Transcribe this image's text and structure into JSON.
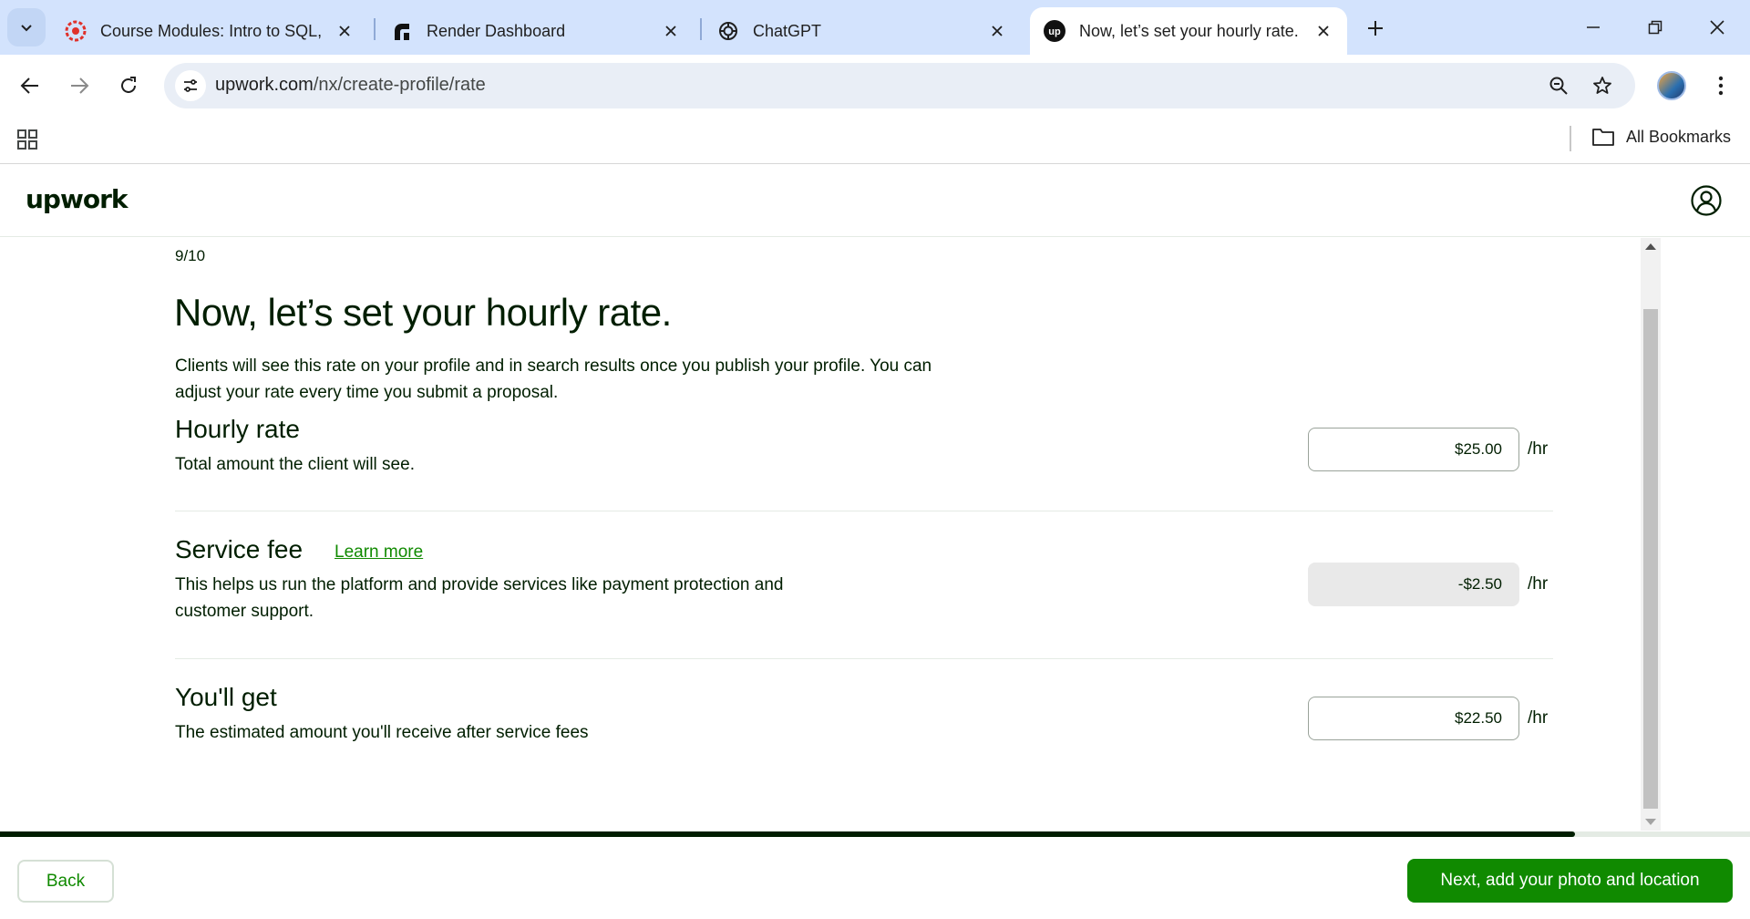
{
  "browser": {
    "tabs": [
      {
        "title": "Course Modules: Intro to SQL, S",
        "icon": "course-favicon"
      },
      {
        "title": "Render Dashboard",
        "icon": "render-favicon"
      },
      {
        "title": "ChatGPT",
        "icon": "chatgpt-favicon"
      },
      {
        "title": "Now, let’s set your hourly rate.",
        "icon": "upwork-favicon",
        "active": true
      }
    ],
    "url_host": "upwork.com",
    "url_path": "/nx/create-profile/rate",
    "bookmarks_label": "All Bookmarks"
  },
  "site": {
    "logo": "upwork"
  },
  "page": {
    "step": "9/10",
    "headline": "Now, let’s set your hourly rate.",
    "intro": "Clients will see this rate on your profile and in search results once you publish your profile. You can adjust your rate every time you submit a proposal.",
    "hourly": {
      "title": "Hourly rate",
      "desc": "Total amount the client will see.",
      "value": "$25.00",
      "unit": "/hr"
    },
    "fee": {
      "title": "Service fee",
      "learn_more": "Learn more",
      "desc": "This helps us run the platform and provide services like payment protection and customer support.",
      "value": "-$2.50",
      "unit": "/hr"
    },
    "net": {
      "title": "You'll get",
      "desc": "The estimated amount you'll receive after service fees",
      "value": "$22.50",
      "unit": "/hr"
    },
    "progress": 0.9
  },
  "footer": {
    "back_label": "Back",
    "next_label": "Next, add your photo and location"
  },
  "colors": {
    "brand_green": "#108a00",
    "text": "#001e00",
    "tabstrip": "#d3e3fd"
  }
}
